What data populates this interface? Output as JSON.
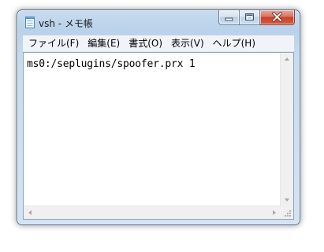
{
  "window": {
    "title": "vsh - メモ帳"
  },
  "menu": {
    "items": [
      {
        "label": "ファイル(F)"
      },
      {
        "label": "編集(E)"
      },
      {
        "label": "書式(O)"
      },
      {
        "label": "表示(V)"
      },
      {
        "label": "ヘルプ(H)"
      }
    ]
  },
  "editor": {
    "content": "ms0:/seplugins/spoofer.prx 1"
  },
  "icons": {
    "app": "notepad-icon",
    "minimize": "minimize-icon",
    "maximize": "maximize-icon",
    "close": "close-icon"
  },
  "colors": {
    "frame": "#b9d1ea",
    "close_button": "#c7412c"
  }
}
